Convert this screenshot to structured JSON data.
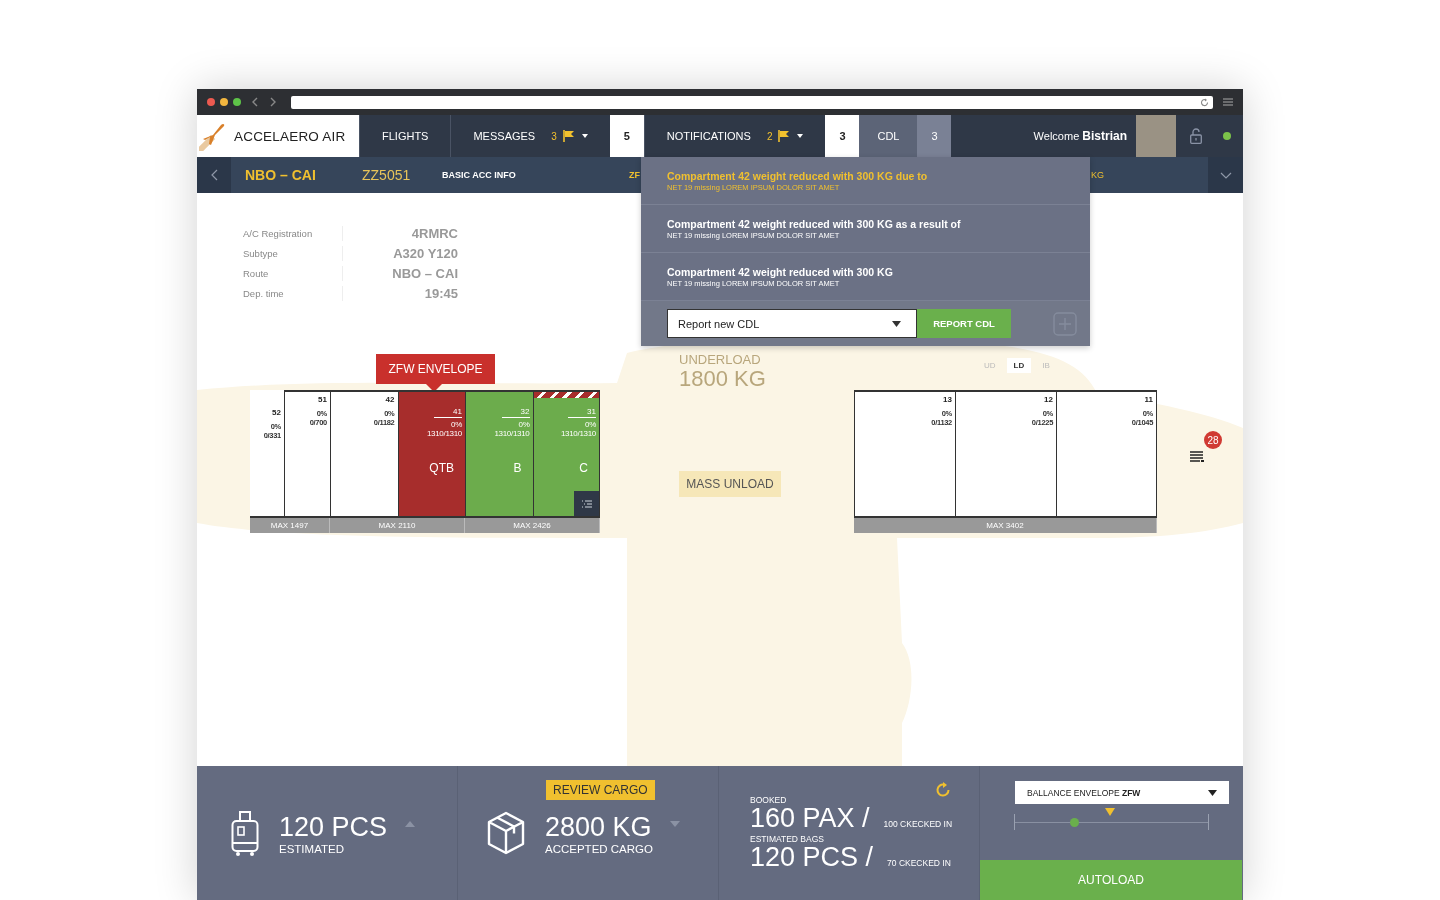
{
  "nav": {
    "logo": "ACCELAERO AIR",
    "tabs": [
      {
        "label": "FLIGHTS",
        "selected": false
      },
      {
        "label": "MESSAGES",
        "flag_count": "3",
        "count": "5",
        "selected": false
      },
      {
        "label": "NOTIFICATIONS",
        "flag_count": "2",
        "count": "3",
        "selected": false
      },
      {
        "label": "CDL",
        "count": "3",
        "selected": true
      }
    ],
    "welcome": "Welcome",
    "user": "Bistrian",
    "online": true
  },
  "subbar": {
    "route": "NBO – CAI",
    "flight": "ZZ5051",
    "items": [
      "BASIC ACC INFO",
      "ZF",
      "KG"
    ]
  },
  "info": [
    {
      "label": "A/C Registration",
      "value": "4RMRC"
    },
    {
      "label": "Subtype",
      "value": "A320 Y120"
    },
    {
      "label": "Route",
      "value": "NBO – CAI"
    },
    {
      "label": "Dep. time",
      "value": "19:45"
    }
  ],
  "cdl_panel": {
    "items": [
      {
        "title": "Compartment 42 weight reduced with 300 KG due to",
        "detail": "NET 19 missing LOREM IPSUM DOLOR SIT AMET",
        "selected": true
      },
      {
        "title": "Compartment 42 weight reduced with 300 KG as a result of",
        "detail": "NET 19 missing LOREM IPSUM DOLOR SIT AMET",
        "selected": false
      },
      {
        "title": "Compartment 42 weight reduced with 300 KG",
        "detail": "NET 19 missing LOREM IPSUM DOLOR SIT AMET",
        "selected": false
      }
    ],
    "select": "Report new CDL",
    "button": "REPORT CDL"
  },
  "underload": {
    "label": "UNDERLOAD",
    "value": "1800 KG"
  },
  "deck_tabs": [
    {
      "label": "UD",
      "selected": false
    },
    {
      "label": "LD",
      "selected": true
    },
    {
      "label": "IB",
      "selected": false
    }
  ],
  "zfw_tag": "ZFW ENVELOPE",
  "mass_unload": "MASS UNLOAD",
  "list_badge": "28",
  "holds": [
    {
      "groups": [
        {
          "max": "MAX 1497",
          "compartments": [
            {
              "number": "52",
              "percent": "0%",
              "weight": "0/331",
              "kind": "empty",
              "tapered": true,
              "hatched": false,
              "details_button": false
            },
            {
              "number": "51",
              "percent": "0%",
              "weight": "0/700",
              "kind": "empty",
              "tapered": false,
              "hatched": false,
              "details_button": false
            }
          ]
        },
        {
          "max": "MAX 2110",
          "compartments": [
            {
              "number": "42",
              "percent": "0%",
              "weight": "0/1182",
              "kind": "empty",
              "tapered": false,
              "hatched": false,
              "details_button": false
            },
            {
              "number": "41",
              "percent": "0%",
              "weight": "1310/1310",
              "label": "QTB",
              "kind": "blocked",
              "tapered": false,
              "hatched": false,
              "details_button": false
            }
          ]
        },
        {
          "max": "MAX 2426",
          "compartments": [
            {
              "number": "32",
              "percent": "0%",
              "weight": "1310/1310",
              "label": "B",
              "kind": "loaded",
              "tapered": false,
              "hatched": false,
              "details_button": false
            },
            {
              "number": "31",
              "percent": "0%",
              "weight": "1310/1310",
              "label": "C",
              "kind": "loaded",
              "tapered": false,
              "hatched": true,
              "details_button": true
            }
          ]
        }
      ]
    },
    {
      "groups": [
        {
          "max": "MAX 3402",
          "compartments": [
            {
              "number": "13",
              "percent": "0%",
              "weight": "0/1132",
              "kind": "empty",
              "tapered": false,
              "hatched": false,
              "details_button": false
            },
            {
              "number": "12",
              "percent": "0%",
              "weight": "0/1225",
              "kind": "empty",
              "tapered": false,
              "hatched": false,
              "details_button": false
            },
            {
              "number": "11",
              "percent": "0%",
              "weight": "0/1045",
              "kind": "empty",
              "tapered": false,
              "hatched": false,
              "details_button": false
            }
          ]
        }
      ]
    }
  ],
  "bottom": {
    "bags": {
      "value": "120 PCS",
      "label": "ESTIMATED"
    },
    "cargo": {
      "tag": "REVIEW CARGO",
      "value": "2800 KG",
      "label": "ACCEPTED CARGO"
    },
    "pax": {
      "booked_label": "BOOKED",
      "booked": "160 PAX /",
      "booked_checked": "100 CKECKED IN",
      "bags_label": "ESTIMATED BAGS",
      "bags": "120 PCS /",
      "bags_checked": "70 CKECKED IN"
    },
    "balance": {
      "select": "BALLANCE ENVELOPE **ZFW**",
      "slider": {
        "level": 0.31,
        "target": {
          "level": 0.49
        }
      },
      "button": "AUTOLOAD"
    }
  }
}
